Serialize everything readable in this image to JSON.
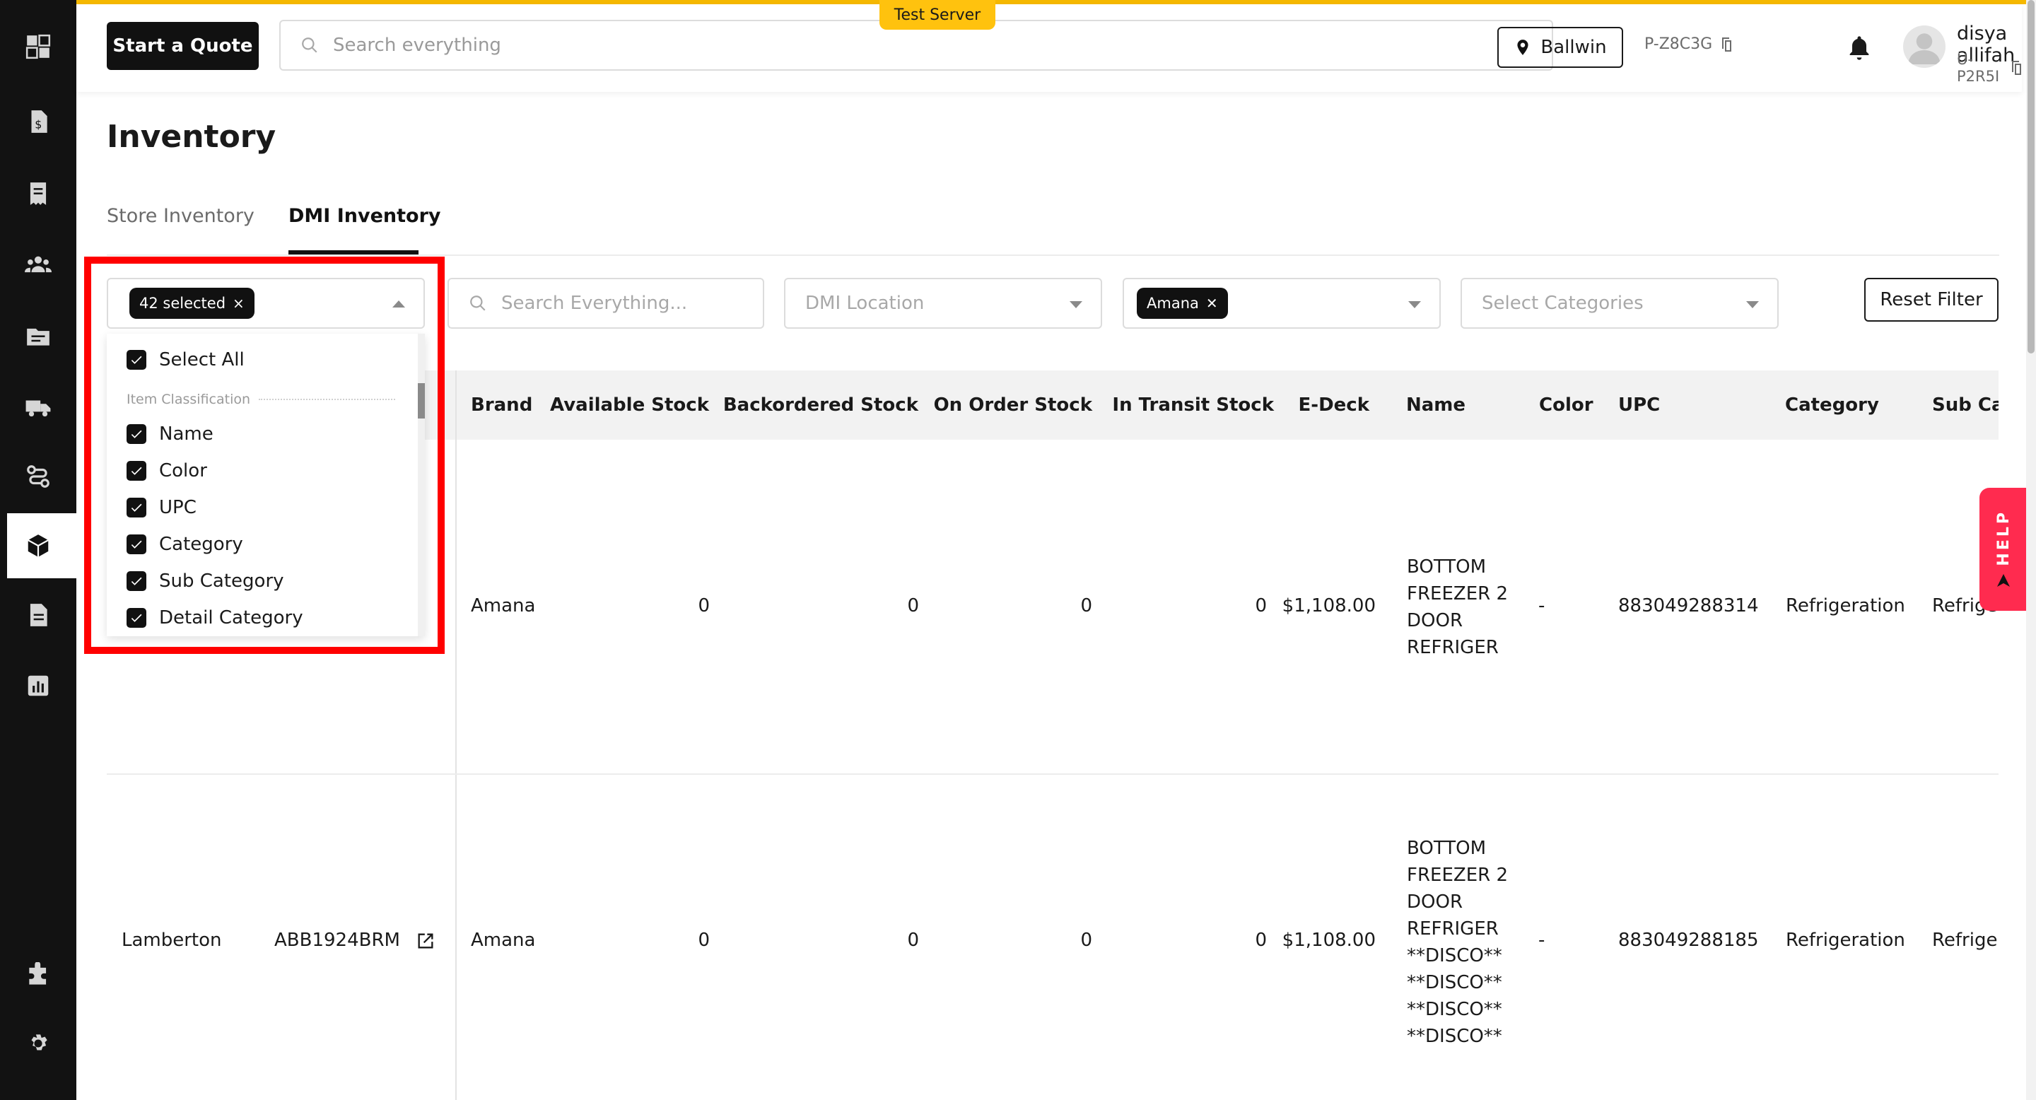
{
  "header": {
    "start_quote": "Start a Quote",
    "search_placeholder": "Search everything",
    "server_badge": "Test Server",
    "location": "Ballwin",
    "profile_code": "P-Z8C3G",
    "user_name": "disya allifah",
    "user_code": "U-P2R5I"
  },
  "sidebar": {
    "items": [
      {
        "icon": "app-grid-icon"
      },
      {
        "icon": "quote-dollar-icon"
      },
      {
        "icon": "receipt-icon"
      },
      {
        "icon": "customers-icon"
      },
      {
        "icon": "folder-icon"
      },
      {
        "icon": "truck-icon"
      },
      {
        "icon": "route-icon"
      },
      {
        "icon": "inventory-box-icon",
        "active": true
      },
      {
        "icon": "document-icon"
      },
      {
        "icon": "reports-chart-icon"
      },
      {
        "icon": "puzzle-icon"
      },
      {
        "icon": "settings-gear-icon"
      }
    ]
  },
  "page": {
    "title": "Inventory",
    "tabs": [
      "Store Inventory",
      "DMI Inventory"
    ],
    "active_tab": "DMI Inventory"
  },
  "filters": {
    "columns_chip": "42 selected",
    "search_placeholder": "Search Everything...",
    "location_placeholder": "DMI Location",
    "brand_chip": "Amana",
    "categories_placeholder": "Select Categories",
    "reset": "Reset Filter"
  },
  "columns_dropdown": {
    "select_all": "Select All",
    "group": "Item Classification",
    "items": [
      "Name",
      "Color",
      "UPC",
      "Category",
      "Sub Category",
      "Detail Category"
    ]
  },
  "table": {
    "headers": [
      "Brand",
      "Available Stock",
      "Backordered Stock",
      "On Order Stock",
      "In Transit Stock",
      "E-Deck",
      "Name",
      "Color",
      "UPC",
      "Category",
      "Sub Ca"
    ],
    "rows": [
      {
        "location": "",
        "model": "",
        "brand": "Amana",
        "available": "0",
        "backordered": "0",
        "on_order": "0",
        "in_transit": "0",
        "edeck": "$1,108.00",
        "name": "BOTTOM FREEZER 2 DOOR REFRIGER",
        "color": "-",
        "upc": "883049288314",
        "category": "Refrigeration",
        "sub": "Refrige"
      },
      {
        "location": "Lamberton",
        "model": "ABB1924BRM",
        "brand": "Amana",
        "available": "0",
        "backordered": "0",
        "on_order": "0",
        "in_transit": "0",
        "edeck": "$1,108.00",
        "name": "BOTTOM FREEZER 2 DOOR REFRIGER **DISCO** **DISCO** **DISCO** **DISCO**",
        "color": "-",
        "upc": "883049288185",
        "category": "Refrigeration",
        "sub": "Refrige"
      }
    ]
  },
  "help": "HELP"
}
